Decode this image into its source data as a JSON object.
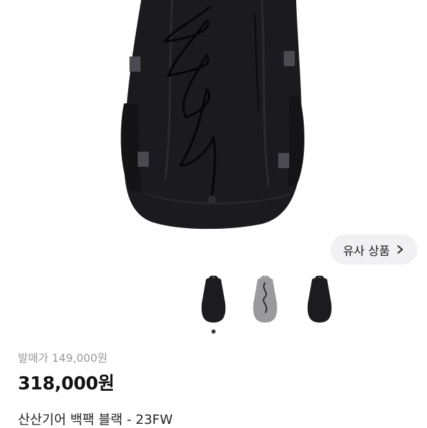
{
  "similar_button": {
    "label": "유사 상품"
  },
  "thumbnails": [
    {
      "name": "black-backpack",
      "color": "#1c1c20"
    },
    {
      "name": "gray-backpack",
      "color": "#9a9a9c"
    },
    {
      "name": "black-backpack-side",
      "color": "#1c1c20"
    }
  ],
  "product": {
    "release_price": "발매가 149,000원",
    "price": "318,000원",
    "name": "산산기어 백팩 블랙 - 23FW"
  },
  "colors": {
    "backpack": "#1a1a1e",
    "accent": "#111111"
  }
}
